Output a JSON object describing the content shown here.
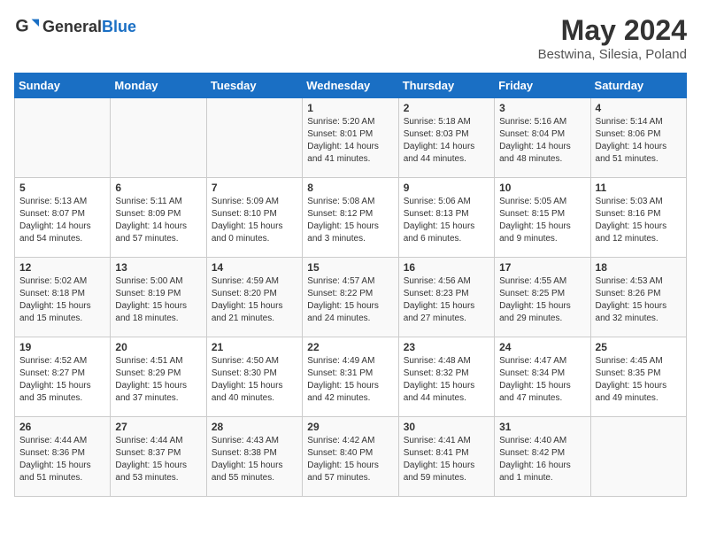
{
  "header": {
    "logo_general": "General",
    "logo_blue": "Blue",
    "title": "May 2024",
    "subtitle": "Bestwina, Silesia, Poland"
  },
  "days_of_week": [
    "Sunday",
    "Monday",
    "Tuesday",
    "Wednesday",
    "Thursday",
    "Friday",
    "Saturday"
  ],
  "weeks": [
    [
      {
        "day": "",
        "info": ""
      },
      {
        "day": "",
        "info": ""
      },
      {
        "day": "",
        "info": ""
      },
      {
        "day": "1",
        "info": "Sunrise: 5:20 AM\nSunset: 8:01 PM\nDaylight: 14 hours\nand 41 minutes."
      },
      {
        "day": "2",
        "info": "Sunrise: 5:18 AM\nSunset: 8:03 PM\nDaylight: 14 hours\nand 44 minutes."
      },
      {
        "day": "3",
        "info": "Sunrise: 5:16 AM\nSunset: 8:04 PM\nDaylight: 14 hours\nand 48 minutes."
      },
      {
        "day": "4",
        "info": "Sunrise: 5:14 AM\nSunset: 8:06 PM\nDaylight: 14 hours\nand 51 minutes."
      }
    ],
    [
      {
        "day": "5",
        "info": "Sunrise: 5:13 AM\nSunset: 8:07 PM\nDaylight: 14 hours\nand 54 minutes."
      },
      {
        "day": "6",
        "info": "Sunrise: 5:11 AM\nSunset: 8:09 PM\nDaylight: 14 hours\nand 57 minutes."
      },
      {
        "day": "7",
        "info": "Sunrise: 5:09 AM\nSunset: 8:10 PM\nDaylight: 15 hours\nand 0 minutes."
      },
      {
        "day": "8",
        "info": "Sunrise: 5:08 AM\nSunset: 8:12 PM\nDaylight: 15 hours\nand 3 minutes."
      },
      {
        "day": "9",
        "info": "Sunrise: 5:06 AM\nSunset: 8:13 PM\nDaylight: 15 hours\nand 6 minutes."
      },
      {
        "day": "10",
        "info": "Sunrise: 5:05 AM\nSunset: 8:15 PM\nDaylight: 15 hours\nand 9 minutes."
      },
      {
        "day": "11",
        "info": "Sunrise: 5:03 AM\nSunset: 8:16 PM\nDaylight: 15 hours\nand 12 minutes."
      }
    ],
    [
      {
        "day": "12",
        "info": "Sunrise: 5:02 AM\nSunset: 8:18 PM\nDaylight: 15 hours\nand 15 minutes."
      },
      {
        "day": "13",
        "info": "Sunrise: 5:00 AM\nSunset: 8:19 PM\nDaylight: 15 hours\nand 18 minutes."
      },
      {
        "day": "14",
        "info": "Sunrise: 4:59 AM\nSunset: 8:20 PM\nDaylight: 15 hours\nand 21 minutes."
      },
      {
        "day": "15",
        "info": "Sunrise: 4:57 AM\nSunset: 8:22 PM\nDaylight: 15 hours\nand 24 minutes."
      },
      {
        "day": "16",
        "info": "Sunrise: 4:56 AM\nSunset: 8:23 PM\nDaylight: 15 hours\nand 27 minutes."
      },
      {
        "day": "17",
        "info": "Sunrise: 4:55 AM\nSunset: 8:25 PM\nDaylight: 15 hours\nand 29 minutes."
      },
      {
        "day": "18",
        "info": "Sunrise: 4:53 AM\nSunset: 8:26 PM\nDaylight: 15 hours\nand 32 minutes."
      }
    ],
    [
      {
        "day": "19",
        "info": "Sunrise: 4:52 AM\nSunset: 8:27 PM\nDaylight: 15 hours\nand 35 minutes."
      },
      {
        "day": "20",
        "info": "Sunrise: 4:51 AM\nSunset: 8:29 PM\nDaylight: 15 hours\nand 37 minutes."
      },
      {
        "day": "21",
        "info": "Sunrise: 4:50 AM\nSunset: 8:30 PM\nDaylight: 15 hours\nand 40 minutes."
      },
      {
        "day": "22",
        "info": "Sunrise: 4:49 AM\nSunset: 8:31 PM\nDaylight: 15 hours\nand 42 minutes."
      },
      {
        "day": "23",
        "info": "Sunrise: 4:48 AM\nSunset: 8:32 PM\nDaylight: 15 hours\nand 44 minutes."
      },
      {
        "day": "24",
        "info": "Sunrise: 4:47 AM\nSunset: 8:34 PM\nDaylight: 15 hours\nand 47 minutes."
      },
      {
        "day": "25",
        "info": "Sunrise: 4:45 AM\nSunset: 8:35 PM\nDaylight: 15 hours\nand 49 minutes."
      }
    ],
    [
      {
        "day": "26",
        "info": "Sunrise: 4:44 AM\nSunset: 8:36 PM\nDaylight: 15 hours\nand 51 minutes."
      },
      {
        "day": "27",
        "info": "Sunrise: 4:44 AM\nSunset: 8:37 PM\nDaylight: 15 hours\nand 53 minutes."
      },
      {
        "day": "28",
        "info": "Sunrise: 4:43 AM\nSunset: 8:38 PM\nDaylight: 15 hours\nand 55 minutes."
      },
      {
        "day": "29",
        "info": "Sunrise: 4:42 AM\nSunset: 8:40 PM\nDaylight: 15 hours\nand 57 minutes."
      },
      {
        "day": "30",
        "info": "Sunrise: 4:41 AM\nSunset: 8:41 PM\nDaylight: 15 hours\nand 59 minutes."
      },
      {
        "day": "31",
        "info": "Sunrise: 4:40 AM\nSunset: 8:42 PM\nDaylight: 16 hours\nand 1 minute."
      },
      {
        "day": "",
        "info": ""
      }
    ]
  ]
}
